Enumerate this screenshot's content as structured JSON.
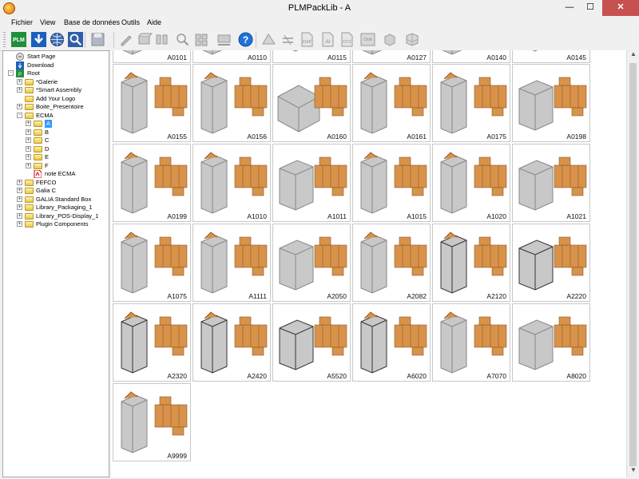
{
  "window": {
    "title": "PLMPackLib - A",
    "min_glyph": "—",
    "max_glyph": "☐",
    "close_glyph": "✕"
  },
  "menu": [
    "Fichier",
    "View",
    "Base de données",
    "Outils",
    "Aide"
  ],
  "toolbar": {
    "buttons": [
      {
        "name": "start-page-icon"
      },
      {
        "name": "download-icon"
      },
      {
        "name": "globe-icon"
      },
      {
        "name": "search-icon"
      },
      {
        "name": "save-icon"
      },
      {
        "name": "edit-parameters-icon"
      },
      {
        "name": "box-view-icon"
      },
      {
        "name": "folding-icon"
      },
      {
        "name": "zoom-fit-icon"
      },
      {
        "name": "layout-icon"
      },
      {
        "name": "pallet-icon"
      },
      {
        "name": "help-icon"
      },
      {
        "name": "design-icon"
      },
      {
        "name": "cut-icon"
      },
      {
        "name": "dxf-export-icon"
      },
      {
        "name": "ai-export-icon"
      },
      {
        "name": "cf2-export-icon"
      },
      {
        "name": "oce-export-icon"
      },
      {
        "name": "3d-box-icon"
      },
      {
        "name": "3d-grid-icon"
      }
    ],
    "labels": {
      "dxf": "DXF",
      "ai": "AI",
      "cf2": "CF2",
      "oce": "Océ"
    }
  },
  "tree": [
    {
      "label": "Start Page",
      "level": 0,
      "icon": "start-page-icon",
      "exp": ""
    },
    {
      "label": "Download",
      "level": 0,
      "icon": "download-icon",
      "exp": ""
    },
    {
      "label": "Root",
      "level": 0,
      "icon": "root-icon",
      "exp": "-"
    },
    {
      "label": "*Galerie",
      "level": 1,
      "icon": "folder-icon",
      "exp": "+"
    },
    {
      "label": "*Smart Assembly",
      "level": 1,
      "icon": "folder-icon",
      "exp": "+"
    },
    {
      "label": "Add Your Logo",
      "level": 1,
      "icon": "folder-icon",
      "exp": ""
    },
    {
      "label": "Boite_Presentoire",
      "level": 1,
      "icon": "folder-icon",
      "exp": "+"
    },
    {
      "label": "ECMA",
      "level": 1,
      "icon": "folder-icon",
      "exp": "-"
    },
    {
      "label": "A",
      "level": 2,
      "icon": "folder-icon",
      "exp": "+",
      "selected": true
    },
    {
      "label": "B",
      "level": 2,
      "icon": "folder-icon",
      "exp": "+"
    },
    {
      "label": "C",
      "level": 2,
      "icon": "folder-icon",
      "exp": "+"
    },
    {
      "label": "D",
      "level": 2,
      "icon": "folder-icon",
      "exp": "+"
    },
    {
      "label": "E",
      "level": 2,
      "icon": "folder-icon",
      "exp": "+"
    },
    {
      "label": "F",
      "level": 2,
      "icon": "folder-icon",
      "exp": "+"
    },
    {
      "label": "note ECMA",
      "level": 2,
      "icon": "pdf-icon",
      "exp": ""
    },
    {
      "label": "FEFCO",
      "level": 1,
      "icon": "folder-icon",
      "exp": "+"
    },
    {
      "label": "Galia C",
      "level": 1,
      "icon": "folder-icon",
      "exp": "+"
    },
    {
      "label": "GALIA Standard Box",
      "level": 1,
      "icon": "folder-icon",
      "exp": "+"
    },
    {
      "label": "Library_Packaging_1",
      "level": 1,
      "icon": "folder-icon",
      "exp": "+"
    },
    {
      "label": "Library_POS-Display_1",
      "level": 1,
      "icon": "folder-icon",
      "exp": "+"
    },
    {
      "label": "Plugin Components",
      "level": 1,
      "icon": "folder-icon",
      "exp": "+"
    }
  ],
  "thumbnails": [
    "A0101",
    "A0110",
    "A0115",
    "A0127",
    "A0140",
    "A0145",
    "A0155",
    "A0156",
    "A0160",
    "A0161",
    "A0175",
    "A0198",
    "A0199",
    "A1010",
    "A1011",
    "A1015",
    "A1020",
    "A1021",
    "A1075",
    "A1111",
    "A2050",
    "A2082",
    "A2120",
    "A2220",
    "A2320",
    "A2420",
    "A5520",
    "A6020",
    "A7070",
    "A8020",
    "A9999"
  ],
  "colors": {
    "carton": "#d9924a",
    "box_gray": "#c8c8c8",
    "selection": "#3399ff",
    "close": "#c75050"
  }
}
